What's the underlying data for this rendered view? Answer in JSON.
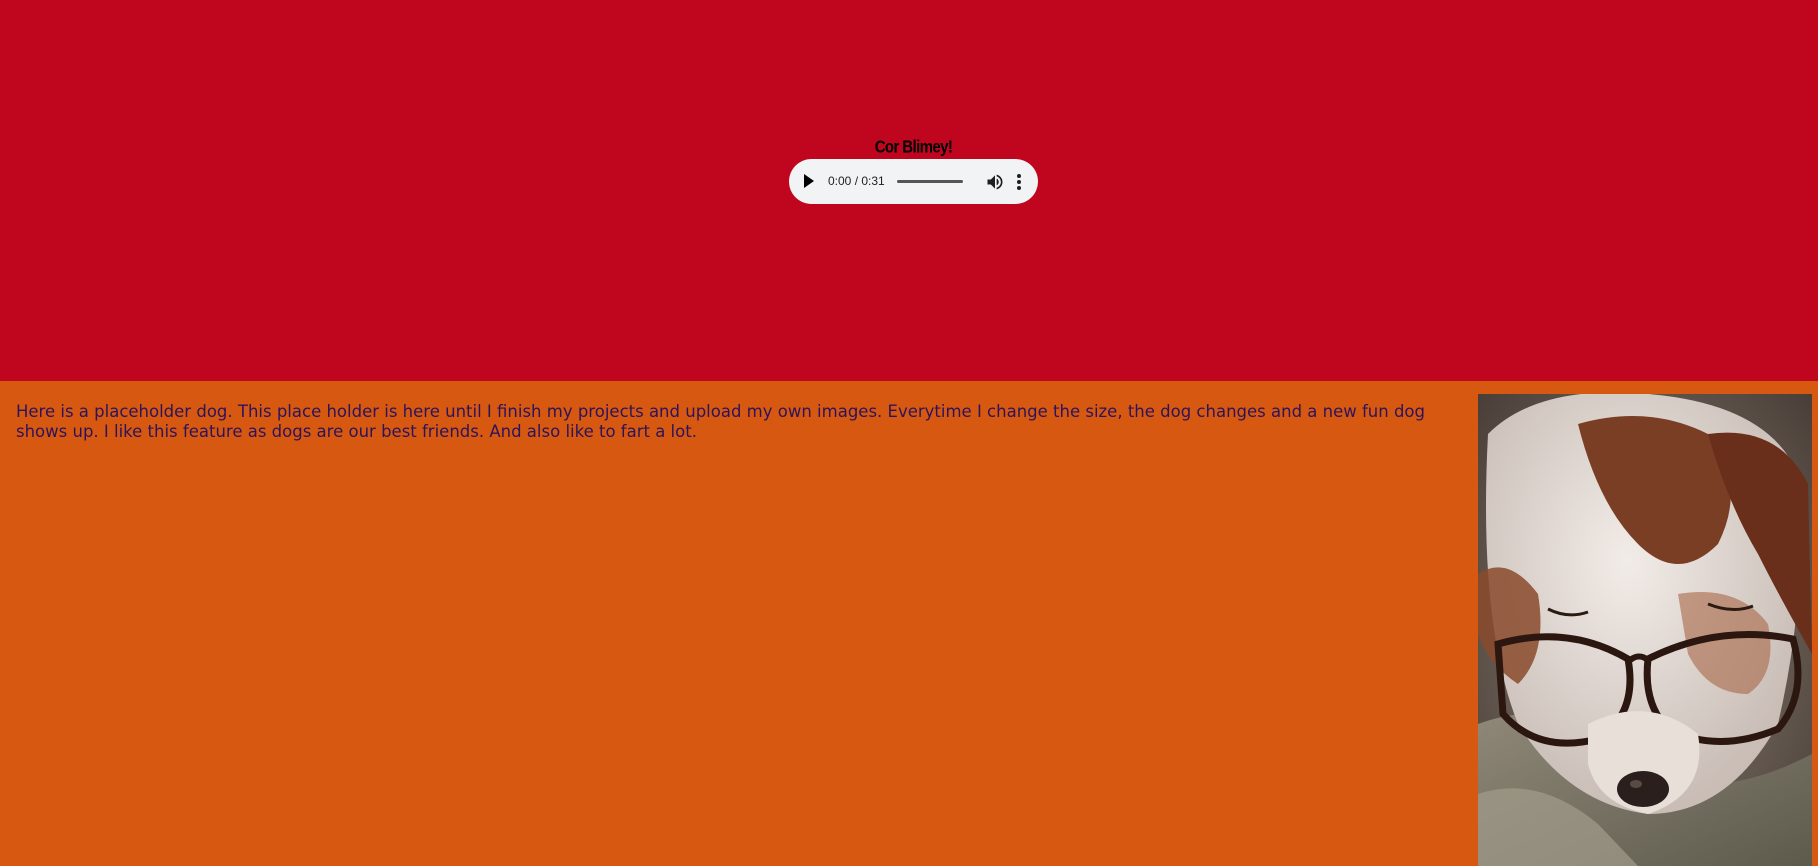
{
  "header": {
    "title": "Cor Blimey!",
    "background": "#c0061f"
  },
  "audio_player": {
    "time_display": "0:00 / 0:31",
    "progress": 0,
    "icons": [
      "play-icon",
      "volume-icon",
      "more-options-icon"
    ]
  },
  "content": {
    "background": "#d75810",
    "text_color": "#2d145a",
    "paragraph": "Here is a placeholder dog. This place holder is here until I finish my projects and upload my own images. Everytime I change the size, the dog changes and a new fun dog shows up. I like this feature as dogs are our best friends. And also like to fart a lot."
  },
  "image": {
    "subject": "dog-with-glasses-photo"
  }
}
